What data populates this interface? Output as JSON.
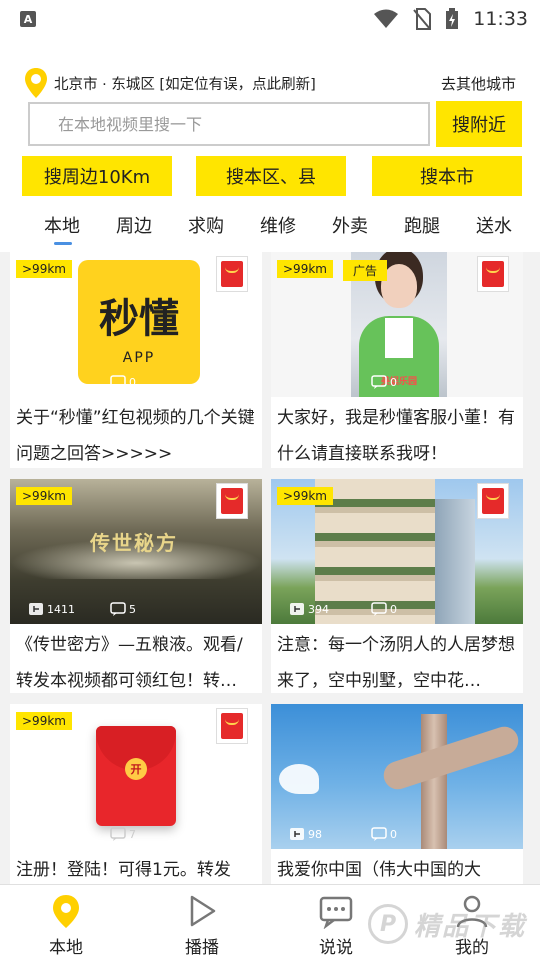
{
  "status_bar": {
    "app_badge": "A",
    "time": "11:33"
  },
  "location": {
    "current": "北京市 · 东城区 [如定位有误，点此刷新]",
    "other_city": "去其他城市"
  },
  "search": {
    "placeholder": "在本地视频里搜一下",
    "value": "",
    "nearby_button": "搜附近"
  },
  "quick_search": [
    "搜周边10Km",
    "搜本区、县",
    "搜本市"
  ],
  "tabs": [
    "本地",
    "周边",
    "求购",
    "维修",
    "外卖",
    "跑腿",
    "送水"
  ],
  "active_tab": "本地",
  "cards": [
    {
      "distance": ">99km",
      "ad": "",
      "thumb_text": "秒懂",
      "thumb_sub": "APP",
      "likes": "",
      "comments": "0",
      "title": "关于“秒懂”红包视频的几个关键问题之回答>>>>>"
    },
    {
      "distance": ">99km",
      "ad": "广告",
      "thumb_caption": "美娱乐园",
      "likes": "",
      "comments": "0",
      "title": "大家好，我是秒懂客服小董！有什么请直接联系我呀！"
    },
    {
      "distance": ">99km",
      "ad": "",
      "thumb_text": "传世秘方",
      "likes": "1411",
      "comments": "5",
      "title": "《传世密方》—五粮液。观看/转发本视频都可领红包！转…"
    },
    {
      "distance": ">99km",
      "ad": "",
      "likes": "394",
      "comments": "0",
      "title": "注意：每一个汤阴人的人居梦想来了，空中别墅，空中花…"
    },
    {
      "distance": ">99km",
      "ad": "",
      "thumb_text": "开",
      "likes": "",
      "comments": "7",
      "title": "注册！登陆！可得1元。转发"
    },
    {
      "distance": "",
      "ad": "",
      "likes": "98",
      "comments": "0",
      "title": "我爱你中国（伟大中国的大"
    }
  ],
  "bottom_nav": [
    "本地",
    "播播",
    "说说",
    "我的"
  ],
  "watermark": {
    "logo": "P",
    "text": "精品下载"
  },
  "colors": {
    "accent_yellow": "#ffe500",
    "red_packet": "#e52a2a",
    "tab_indicator": "#4a90e2"
  }
}
